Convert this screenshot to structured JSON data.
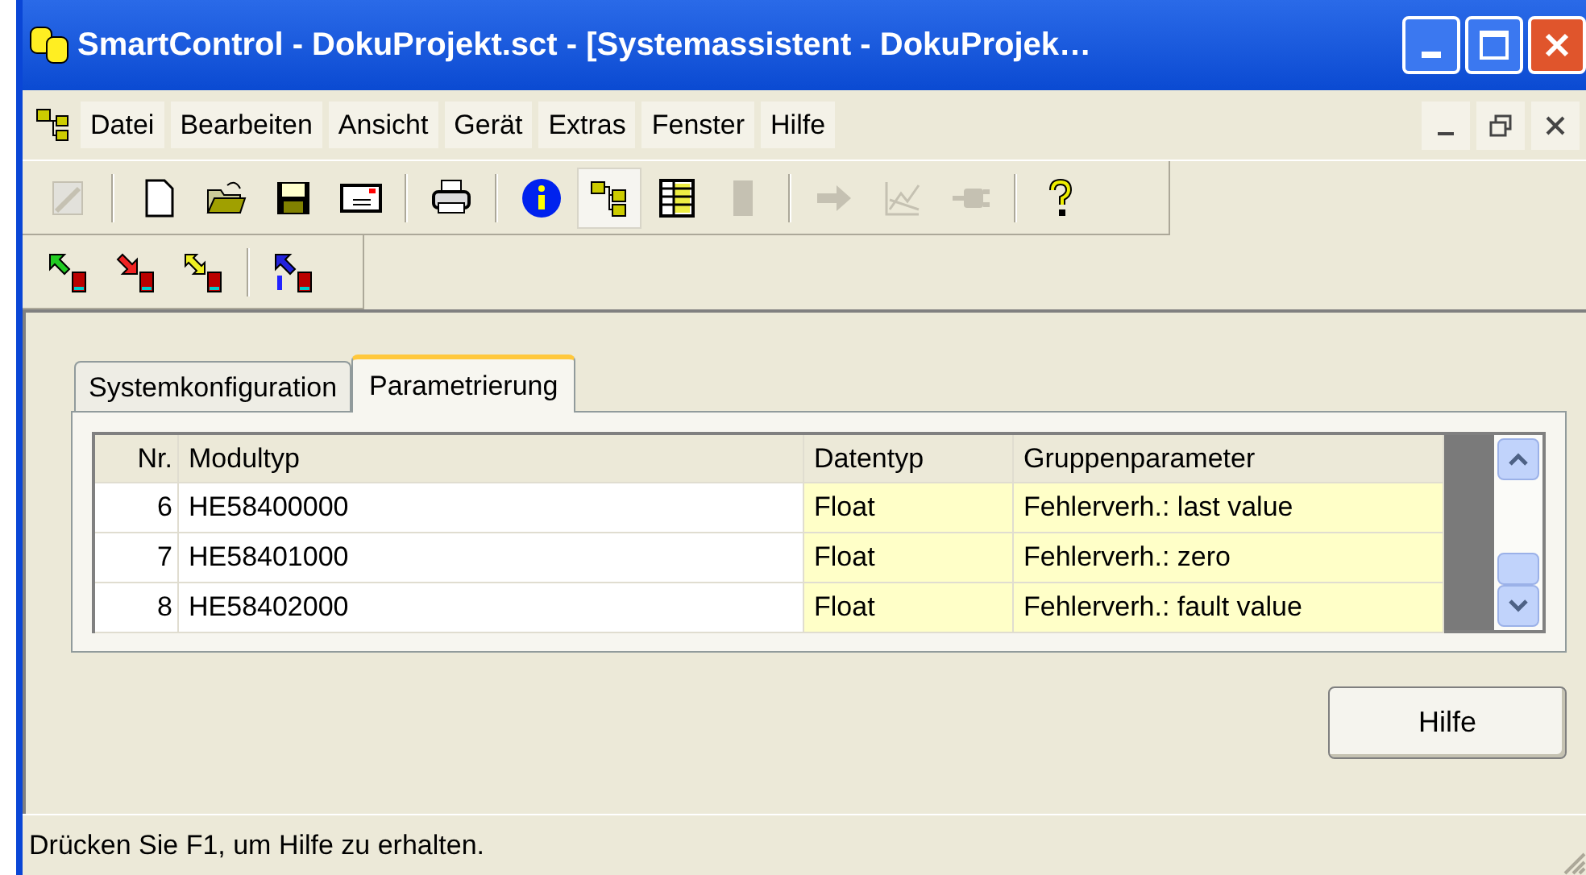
{
  "window": {
    "title": "SmartControl - DokuProjekt.sct - [Systemassistent - DokuProjek…"
  },
  "menu": [
    "Datei",
    "Bearbeiten",
    "Ansicht",
    "Gerät",
    "Extras",
    "Fenster",
    "Hilfe"
  ],
  "toolbar": [
    {
      "kind": "edit",
      "disabled": true
    },
    {
      "kind": "sep"
    },
    {
      "kind": "new",
      "disabled": false
    },
    {
      "kind": "open",
      "disabled": false
    },
    {
      "kind": "save",
      "disabled": false
    },
    {
      "kind": "mail",
      "disabled": false
    },
    {
      "kind": "sep"
    },
    {
      "kind": "print",
      "disabled": false
    },
    {
      "kind": "sep"
    },
    {
      "kind": "info",
      "disabled": false
    },
    {
      "kind": "tree",
      "disabled": false,
      "pressed": true
    },
    {
      "kind": "table",
      "disabled": false
    },
    {
      "kind": "block",
      "disabled": true
    },
    {
      "kind": "sep"
    },
    {
      "kind": "arrow",
      "disabled": true
    },
    {
      "kind": "chart",
      "disabled": true
    },
    {
      "kind": "plug",
      "disabled": true
    },
    {
      "kind": "sep"
    },
    {
      "kind": "help",
      "disabled": false
    }
  ],
  "toolbar2": [
    {
      "kind": "upload"
    },
    {
      "kind": "download"
    },
    {
      "kind": "sync"
    },
    {
      "kind": "sep"
    },
    {
      "kind": "devinfo"
    }
  ],
  "tabs": [
    {
      "label": "Systemkonfiguration",
      "selected": false
    },
    {
      "label": "Parametrierung",
      "selected": true
    }
  ],
  "table": {
    "columns": [
      "Nr.",
      "Modultyp",
      "Datentyp",
      "Gruppenparameter"
    ],
    "rows": [
      [
        "6",
        "HE58400000",
        "Float",
        "Fehlerverh.: last value"
      ],
      [
        "7",
        "HE58401000",
        "Float",
        "Fehlerverh.: zero"
      ],
      [
        "8",
        "HE58402000",
        "Float",
        "Fehlerverh.: fault value"
      ]
    ]
  },
  "help_button": "Hilfe",
  "status_bar": "Drücken Sie F1, um Hilfe zu erhalten."
}
